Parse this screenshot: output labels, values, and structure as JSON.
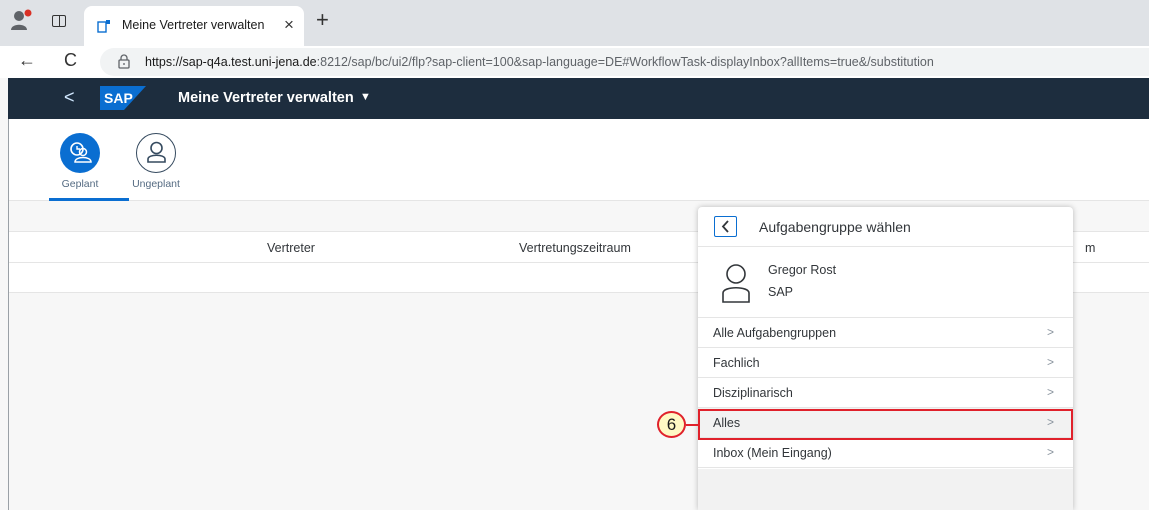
{
  "browser": {
    "tab_title": "Meine Vertreter verwalten",
    "tab_close": "×",
    "new_tab": "+",
    "back": "←",
    "reload": "C",
    "url_host": "https://sap-q4a.test.uni-jena.de",
    "url_rest": ":8212/sap/bc/ui2/flp?sap-client=100&sap-language=DE#WorkflowTask-displayInbox?allItems=true&/substitution"
  },
  "shell": {
    "back": "<",
    "logo_text": "SAP",
    "app_title": "Meine Vertreter verwalten",
    "app_caret": "▼",
    "brand_color": "#0a6ed1",
    "bar_color": "#1d2d3e"
  },
  "icon_tabs": [
    {
      "label": "Geplant",
      "icon": "scheduled-person-icon",
      "selected": true
    },
    {
      "label": "Ungeplant",
      "icon": "person-icon",
      "selected": false
    }
  ],
  "table": {
    "columns": [
      "Vertreter",
      "Vertretungszeitraum",
      "m"
    ]
  },
  "popover": {
    "title": "Aufgabengruppe wählen",
    "user_name": "Gregor Rost",
    "user_org": "SAP",
    "items": [
      {
        "label": "Alle Aufgabengruppen"
      },
      {
        "label": "Fachlich"
      },
      {
        "label": "Disziplinarisch"
      },
      {
        "label": "Alles"
      },
      {
        "label": "Inbox (Mein Eingang)"
      }
    ],
    "chevron": ">"
  },
  "annotation": {
    "step_number": "6",
    "highlight_color": "#e0212b"
  }
}
